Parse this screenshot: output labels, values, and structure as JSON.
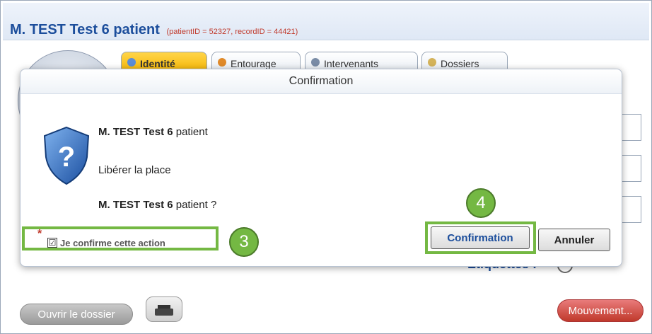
{
  "header": {
    "patient_name": "M. TEST Test 6 patient",
    "ids": "(patientID = 52327, recordID = 44421)"
  },
  "tabs": [
    {
      "label": "Identité"
    },
    {
      "label": "Entourage"
    },
    {
      "label": "Intervenants"
    },
    {
      "label": "Dossiers"
    }
  ],
  "dialog": {
    "title": "Confirmation",
    "line1_name": "M. TEST Test 6",
    "line1_suffix": " patient",
    "line2": "Libérer la place",
    "line3_name": "M. TEST Test 6",
    "line3_suffix": " patient ?",
    "required_marker": "*",
    "checkbox_label": "Je confirme cette action",
    "checkbox_checked": "☑",
    "confirm_label": "Confirmation",
    "cancel_label": "Annuler"
  },
  "annotations": {
    "badge3": "3",
    "badge4": "4"
  },
  "page": {
    "etiquettes_label": "Etiquettes :",
    "open_record_label": "Ouvrir le dossier",
    "movement_label": "Mouvement..."
  },
  "colors": {
    "accent_blue": "#1c4e9c",
    "highlight_green": "#74b843",
    "danger_red": "#c0392b"
  }
}
